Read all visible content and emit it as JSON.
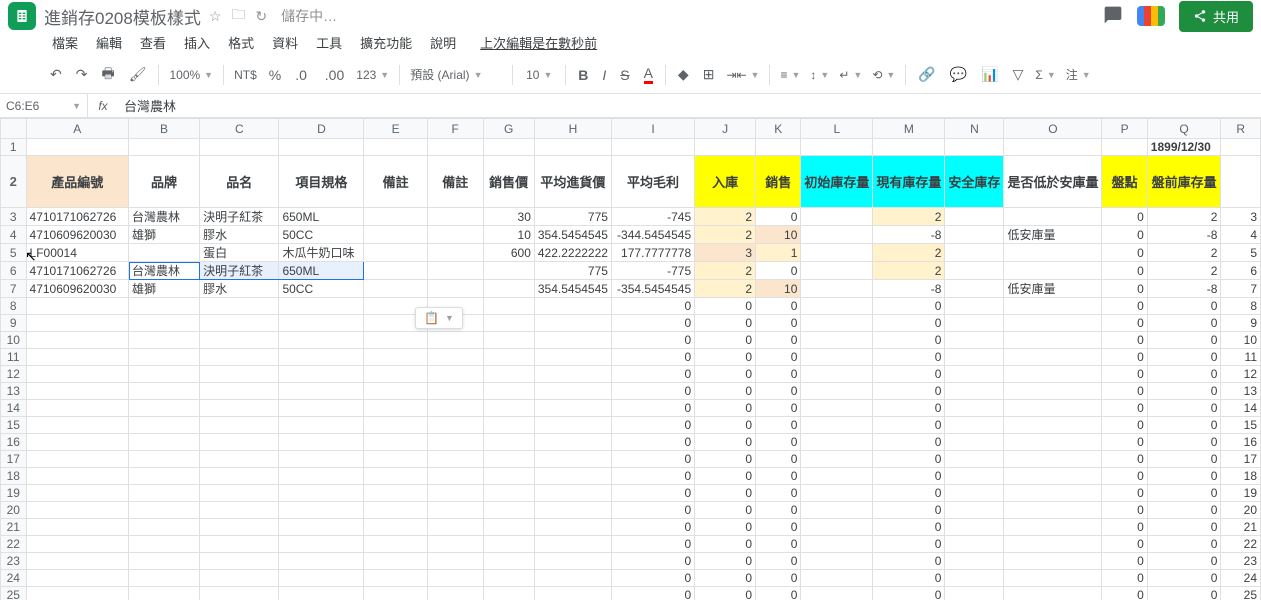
{
  "app": {
    "title": "進銷存0208模板樣式",
    "saving": "儲存中…"
  },
  "menus": [
    "檔案",
    "編輯",
    "查看",
    "插入",
    "格式",
    "資料",
    "工具",
    "擴充功能",
    "說明"
  ],
  "last_edit": "上次編輯是在數秒前",
  "toolbar": {
    "zoom": "100%",
    "currency": "NT$",
    "font": "預設 (Arial)",
    "size": "10"
  },
  "namebox": "C6:E6",
  "fx_value": "台灣農林",
  "share": "共用",
  "columns": [
    "A",
    "B",
    "C",
    "D",
    "E",
    "F",
    "G",
    "H",
    "I",
    "J",
    "K",
    "L",
    "M",
    "N",
    "O",
    "P",
    "Q",
    "R"
  ],
  "row1": {
    "q": "1899/12/30"
  },
  "headers": {
    "a": "產品編號",
    "b": "品牌",
    "c": "品名",
    "d": "項目規格",
    "e": "備註",
    "f": "備註",
    "g": "銷售價",
    "h": "平均進貨價",
    "i": "平均毛利",
    "j": "入庫",
    "k": "銷售",
    "l": "初始庫存量",
    "m": "現有庫存量",
    "n": "安全庫存",
    "o": "是否低於安庫量",
    "p": "盤點",
    "q": "盤前庫存量"
  },
  "rows": [
    {
      "r": 3,
      "a": "4710171062726",
      "b": "台灣農林",
      "c": "決明子紅茶",
      "d": "650ML",
      "g": "30",
      "h": "775",
      "i": "-745",
      "j": "2",
      "k": "0",
      "m": "2",
      "p": "0",
      "q": "2"
    },
    {
      "r": 4,
      "a": "4710609620030",
      "b": "雄獅",
      "c": "膠水",
      "d": "50CC",
      "g": "10",
      "h": "354.5454545",
      "i": "-344.5454545",
      "j": "2",
      "k": "10",
      "m": "-8",
      "o": "低安庫量",
      "p": "0",
      "q": "-8"
    },
    {
      "r": 5,
      "a": "LF00014",
      "c": "蛋白",
      "d": "木瓜牛奶口味",
      "g": "600",
      "h": "422.2222222",
      "i": "177.7777778",
      "j": "3",
      "k": "1",
      "m": "2",
      "p": "0",
      "q": "2"
    },
    {
      "r": 6,
      "a": "4710171062726",
      "b": "台灣農林",
      "c": "決明子紅茶",
      "d": "650ML",
      "h": "775",
      "i": "-775",
      "j": "2",
      "k": "0",
      "m": "2",
      "p": "0",
      "q": "2",
      "sel": true
    },
    {
      "r": 7,
      "a": "4710609620030",
      "b": "雄獅",
      "c": "膠水",
      "d": "50CC",
      "h": "354.5454545",
      "i": "-354.5454545",
      "j": "2",
      "k": "10",
      "m": "-8",
      "o": "低安庫量",
      "p": "0",
      "q": "-8"
    },
    {
      "r": 8,
      "i": "0",
      "j": "0",
      "k": "0",
      "m": "0",
      "p": "0",
      "q": "0"
    },
    {
      "r": 9,
      "i": "0",
      "j": "0",
      "k": "0",
      "m": "0",
      "p": "0",
      "q": "0"
    },
    {
      "r": 10,
      "i": "0",
      "j": "0",
      "k": "0",
      "m": "0",
      "p": "0",
      "q": "0"
    },
    {
      "r": 11,
      "i": "0",
      "j": "0",
      "k": "0",
      "m": "0",
      "p": "0",
      "q": "0"
    },
    {
      "r": 12,
      "i": "0",
      "j": "0",
      "k": "0",
      "m": "0",
      "p": "0",
      "q": "0"
    },
    {
      "r": 13,
      "i": "0",
      "j": "0",
      "k": "0",
      "m": "0",
      "p": "0",
      "q": "0"
    },
    {
      "r": 14,
      "i": "0",
      "j": "0",
      "k": "0",
      "m": "0",
      "p": "0",
      "q": "0"
    },
    {
      "r": 15,
      "i": "0",
      "j": "0",
      "k": "0",
      "m": "0",
      "p": "0",
      "q": "0"
    },
    {
      "r": 16,
      "i": "0",
      "j": "0",
      "k": "0",
      "m": "0",
      "p": "0",
      "q": "0"
    },
    {
      "r": 17,
      "i": "0",
      "j": "0",
      "k": "0",
      "m": "0",
      "p": "0",
      "q": "0"
    },
    {
      "r": 18,
      "i": "0",
      "j": "0",
      "k": "0",
      "m": "0",
      "p": "0",
      "q": "0"
    },
    {
      "r": 19,
      "i": "0",
      "j": "0",
      "k": "0",
      "m": "0",
      "p": "0",
      "q": "0"
    },
    {
      "r": 20,
      "i": "0",
      "j": "0",
      "k": "0",
      "m": "0",
      "p": "0",
      "q": "0"
    },
    {
      "r": 21,
      "i": "0",
      "j": "0",
      "k": "0",
      "m": "0",
      "p": "0",
      "q": "0"
    },
    {
      "r": 22,
      "i": "0",
      "j": "0",
      "k": "0",
      "m": "0",
      "p": "0",
      "q": "0"
    },
    {
      "r": 23,
      "i": "0",
      "j": "0",
      "k": "0",
      "m": "0",
      "p": "0",
      "q": "0"
    },
    {
      "r": 24,
      "i": "0",
      "j": "0",
      "k": "0",
      "m": "0",
      "p": "0",
      "q": "0"
    },
    {
      "r": 25,
      "i": "0",
      "j": "0",
      "k": "0",
      "m": "0",
      "p": "0",
      "q": "0"
    }
  ],
  "paste_hint": "📋"
}
